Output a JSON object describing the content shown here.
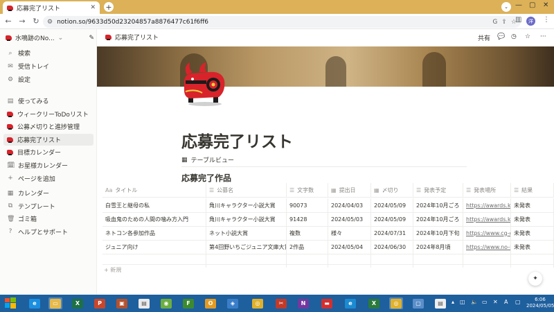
{
  "browser": {
    "tab_title": "応募完了リスト",
    "url": "notion.so/9633d50d23204857a8876477c61f6ff6",
    "profile_initial": "B",
    "omni_profile": "洋"
  },
  "sidebar": {
    "workspace": "水鳴跡のNo...",
    "top_items": [
      {
        "icon": "search-icon",
        "label": "検索"
      },
      {
        "icon": "inbox-icon",
        "label": "受信トレイ"
      },
      {
        "icon": "gear-icon",
        "label": "設定"
      }
    ],
    "pages": [
      {
        "icon": "page-icon",
        "label": "使ってみる"
      },
      {
        "icon": "akabeko-icon",
        "label": "ウィークリーToDoリスト"
      },
      {
        "icon": "akabeko-icon",
        "label": "公募〆切りと進捗管理"
      },
      {
        "icon": "akabeko-icon",
        "label": "応募完了リスト"
      },
      {
        "icon": "akabeko-icon",
        "label": "目標カレンダー"
      },
      {
        "icon": "calendar-emoji-icon",
        "label": "お星様カレンダー"
      },
      {
        "icon": "plus-icon",
        "label": "ページを追加"
      }
    ],
    "bottom_items": [
      {
        "icon": "calendar-icon",
        "label": "カレンダー"
      },
      {
        "icon": "template-icon",
        "label": "テンプレート"
      },
      {
        "icon": "trash-icon",
        "label": "ゴミ箱"
      },
      {
        "icon": "help-icon",
        "label": "ヘルプとサポート"
      }
    ]
  },
  "topbar": {
    "breadcrumb": "応募完了リスト",
    "share": "共有"
  },
  "page": {
    "title": "応募完了リスト",
    "view_label": "テーブルビュー",
    "db_title": "応募完了作品",
    "new_row": "+ 新規"
  },
  "table": {
    "headers": [
      {
        "icon": "Aa",
        "label": "タイトル"
      },
      {
        "icon": "☰",
        "label": "公募名"
      },
      {
        "icon": "☰",
        "label": "文字数"
      },
      {
        "icon": "▦",
        "label": "提出日"
      },
      {
        "icon": "▦",
        "label": "〆切り"
      },
      {
        "icon": "☰",
        "label": "発表予定"
      },
      {
        "icon": "☰",
        "label": "発表場所"
      },
      {
        "icon": "☰",
        "label": "結果"
      }
    ],
    "rows": [
      [
        "白雪王と継母の私",
        "角川キャラクター小説大賞",
        "90073",
        "2024/04/03",
        "2024/05/09",
        "2024年10月ごろ",
        "https://awards.kad",
        "未発表"
      ],
      [
        "吸血鬼のための人間の噛み方入門",
        "角川キャラクター小説大賞",
        "91428",
        "2024/05/03",
        "2024/05/09",
        "2024年10月ごろ",
        "https://awards.kad",
        "未発表"
      ],
      [
        "ネトコン各参加作品",
        "ネット小説大賞",
        "複数",
        "様々",
        "2024/07/31",
        "2024年10月下旬",
        "https://www.cg-co",
        "未発表"
      ],
      [
        "ジュニア向け",
        "第4回野いちごジュニア文庫大賞",
        "2作品",
        "2024/05/04",
        "2024/06/30",
        "2024年8月頃",
        "https://www.no-ic",
        "未発表"
      ]
    ]
  },
  "taskbar": {
    "time": "6:06",
    "date": "2024/05/05"
  }
}
